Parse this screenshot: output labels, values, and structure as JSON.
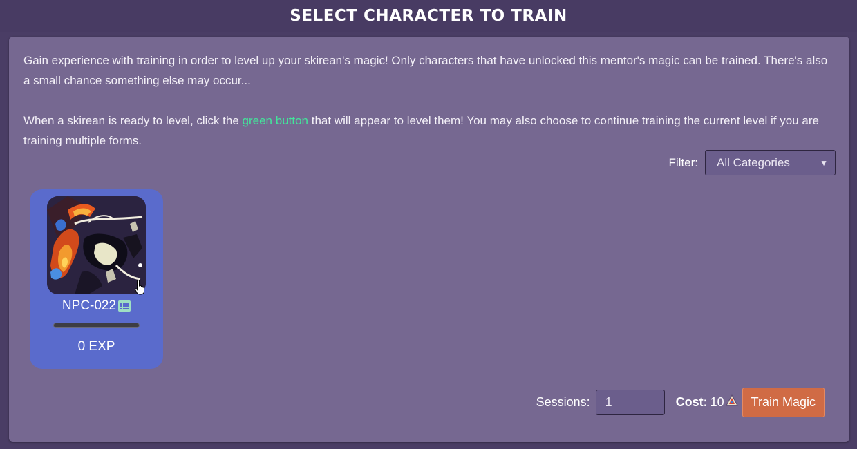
{
  "header": {
    "title": "SELECT CHARACTER TO TRAIN"
  },
  "intro": {
    "p1": "Gain experience with training in order to level up your skirean's magic! Only characters that have unlocked this mentor's magic can be trained. There's also a small chance something else may occur...",
    "p2_before": "When a skirean is ready to level, click the ",
    "p2_green": "green button",
    "p2_after": " that will appear to level them! You may also choose to continue training the current level if you are training multiple forms."
  },
  "filter": {
    "label": "Filter:",
    "selected": "All Categories"
  },
  "characters": [
    {
      "name": "NPC-022",
      "exp": "0 EXP",
      "progress": 0
    }
  ],
  "footer": {
    "sessions_label": "Sessions:",
    "sessions_value": "1",
    "cost_label": "Cost:",
    "cost_value": "10",
    "train_label": "Train Magic"
  },
  "colors": {
    "background": "#4a3d65",
    "panel": "#766891",
    "card": "#5a6bcc",
    "accent_green": "#43e59b",
    "button": "#d06b45"
  }
}
